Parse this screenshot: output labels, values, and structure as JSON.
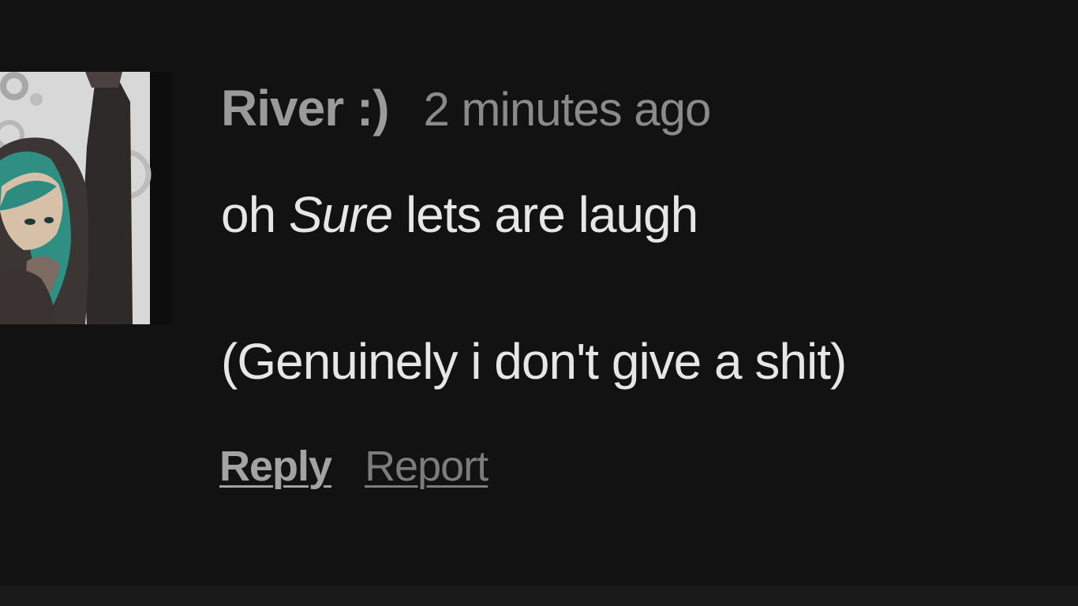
{
  "comment": {
    "author": "River :)",
    "timestamp": "2 minutes ago",
    "body": {
      "line1_prefix": "oh ",
      "line1_emphasis": "Sure",
      "line1_suffix": " lets are laugh",
      "line2": "(Genuinely i don't give a shit)"
    },
    "actions": {
      "reply_label": "Reply",
      "report_label": "Report"
    },
    "avatar": {
      "icon": "user-avatar-image"
    }
  },
  "colors": {
    "background": "#121212",
    "author": "#9a9a9a",
    "timestamp": "#8a8a8a",
    "body_text": "#e6e6e6",
    "reply": "#a3a3a3",
    "report": "#7c7c7c",
    "avatar_accent": "#2f8f83"
  }
}
